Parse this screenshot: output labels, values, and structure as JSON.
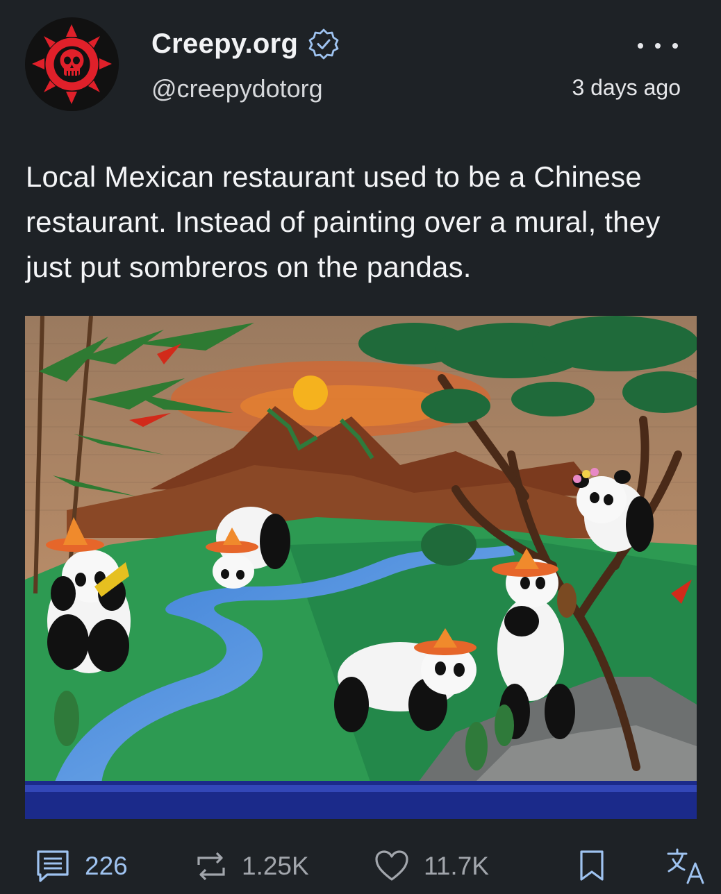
{
  "author": {
    "display_name": "Creepy.org",
    "handle": "@creepydotorg",
    "verified_icon": "verified-badge-icon",
    "avatar": "creepy-org-logo"
  },
  "post": {
    "timestamp": "3 days ago",
    "text": "Local Mexican restaurant used to be a Chinese restaurant. Instead of painting over a mural, they just put sombreros on the pandas.",
    "media": "mural-photo-pandas-in-sombreros"
  },
  "actions": {
    "comments": {
      "icon": "comment-icon",
      "count": "226"
    },
    "reposts": {
      "icon": "repost-icon",
      "count": "1.25K"
    },
    "likes": {
      "icon": "heart-icon",
      "count": "11.7K"
    },
    "bookmark": {
      "icon": "bookmark-icon"
    },
    "translate": {
      "icon": "translate-icon"
    }
  },
  "colors": {
    "background": "#1e2226",
    "accent": "#9fc3f0",
    "muted": "#a2a6ac",
    "brand_red": "#e0202a"
  }
}
